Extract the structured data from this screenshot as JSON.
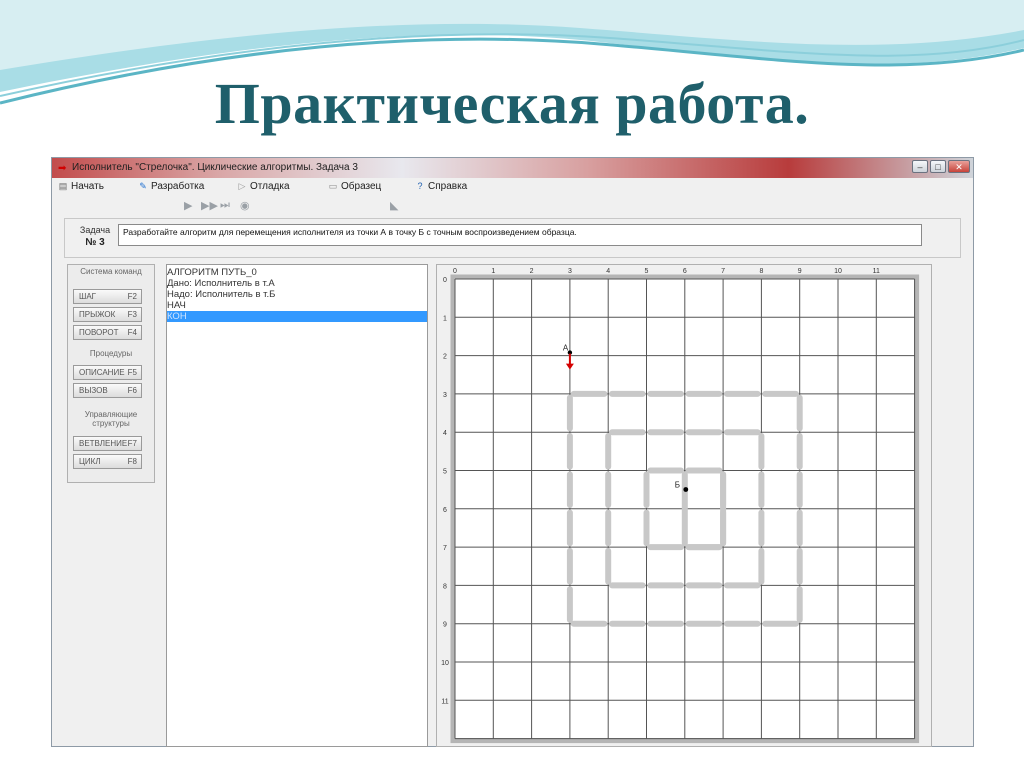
{
  "slide_title": "Практическая работа.",
  "window": {
    "title": "Исполнитель \"Стрелочка\". Циклические алгоритмы. Задача 3",
    "controls": {
      "minimize": "‒",
      "maximize": "□",
      "close": "✕"
    }
  },
  "menu": [
    {
      "label": "Начать",
      "icon": "start-icon"
    },
    {
      "label": "Разработка",
      "icon": "develop-icon"
    },
    {
      "label": "Отладка",
      "icon": "debug-play-icon"
    },
    {
      "label": "Образец",
      "icon": "sample-icon"
    },
    {
      "label": "Справка",
      "icon": "help-icon"
    }
  ],
  "toolbar": [
    "play-icon",
    "step-icon",
    "fast-forward-icon",
    "stop-icon",
    "eraser-icon"
  ],
  "task": {
    "label": "Задача",
    "number": "№ 3",
    "text": "Разработайте алгоритм для перемещения исполнителя из точки А в точку Б с точным воспроизведением образца."
  },
  "commands": {
    "system_header": "Система команд",
    "system": [
      {
        "name": "ШАГ",
        "key": "F2"
      },
      {
        "name": "ПРЫЖОК",
        "key": "F3"
      },
      {
        "name": "ПОВОРОТ",
        "key": "F4"
      }
    ],
    "procedures_header": "Процедуры",
    "procedures": [
      {
        "name": "ОПИСАНИЕ",
        "key": "F5"
      },
      {
        "name": "ВЫЗОВ",
        "key": "F6"
      }
    ],
    "control_header": "Управляющие структуры",
    "control": [
      {
        "name": "ВЕТВЛЕНИЕ",
        "key": "F7"
      },
      {
        "name": "ЦИКЛ",
        "key": "F8"
      }
    ]
  },
  "code": [
    "АЛГОРИТМ ПУТЬ_0",
    "    Дано: Исполнитель в т.А",
    "    Надо: Исполнитель в т.Б",
    "НАЧ",
    "КОН"
  ],
  "code_selected_index": 4,
  "grid": {
    "columns": [
      "0",
      "1",
      "2",
      "3",
      "4",
      "5",
      "6",
      "7",
      "8",
      "9",
      "10",
      "11"
    ],
    "rows": [
      "0",
      "1",
      "2",
      "3",
      "4",
      "5",
      "6",
      "7",
      "8",
      "9",
      "10",
      "11"
    ],
    "point_a": {
      "label": "А",
      "col": 3,
      "row": 2
    },
    "point_b": {
      "label": "Б",
      "col": 6,
      "row": 5
    },
    "colors": {
      "path": "#c8c8c8",
      "arrow": "#d40000",
      "grid_line": "#555555"
    }
  }
}
